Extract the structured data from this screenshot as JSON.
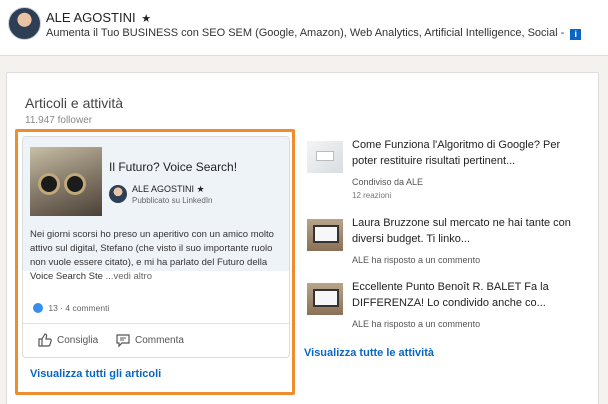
{
  "profile": {
    "name": "ALE AGOSTINI",
    "star": "★",
    "headline": "Aumenta il Tuo BUSINESS con SEO SEM (Google, Amazon), Web Analytics, Artificial Intelligence, Social -",
    "info_icon": "i"
  },
  "section": {
    "title": "Articoli e attività",
    "followers": "11.947 follower"
  },
  "article": {
    "title": "Il Futuro? Voice Search!",
    "author": "ALE AGOSTINI ★",
    "published": "Pubblicato su LinkedIn",
    "excerpt": "Nei giorni scorsi ho preso un aperitivo con un amico molto attivo sul digital, Stefano (che visto il suo importante ruolo non vuole essere citato), e mi ha parlato del Futuro della Voice Search Ste",
    "more": " ...vedi altro",
    "stats": "13 · 4 commenti",
    "like_label": "Consiglia",
    "comment_label": "Commenta",
    "see_all": "Visualizza tutti gli articoli"
  },
  "activities": [
    {
      "title": "Come Funziona l'Algoritmo di Google? Per poter restituire risultati pertinent...",
      "meta": "Condiviso da ALE",
      "sub": "12 reazioni",
      "thumb_icon": "google-screen-thumbnail"
    },
    {
      "title": "Laura Bruzzone sul mercato ne hai tante con diversi budget. Ti linko...",
      "meta": "ALE ha risposto a un commento",
      "thumb_icon": "laptop-thumbnail"
    },
    {
      "title": "Eccellente Punto Benoît R. BALET Fa la DIFFERENZA! Lo condivido anche co...",
      "meta": "ALE ha risposto a un commento",
      "thumb_icon": "laptop-thumbnail"
    }
  ],
  "see_activities": "Visualizza tutte le attività",
  "colors": {
    "accent": "#0a66c2",
    "highlight_border": "#f08c30"
  }
}
